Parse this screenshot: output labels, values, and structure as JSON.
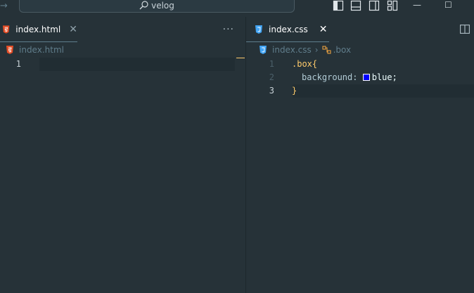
{
  "titlebar": {
    "search_text": "velog",
    "back_icon": "arrow-right-icon",
    "layout_icons": [
      "toggle-primary-sidebar-icon",
      "toggle-panel-icon",
      "toggle-secondary-sidebar-icon",
      "customize-layout-icon"
    ],
    "controls": {
      "minimize": "—",
      "maximize": "☐"
    }
  },
  "left_pane": {
    "tab": {
      "label": "index.html",
      "close": "✕",
      "icon": "html5-icon",
      "icon_color": "#e44d26"
    },
    "more_actions": "···",
    "breadcrumb": {
      "file": "index.html"
    },
    "lines": [
      {
        "number": "1",
        "text": ""
      }
    ]
  },
  "right_pane": {
    "tab": {
      "label": "index.css",
      "close": "✕",
      "icon": "css3-icon",
      "icon_color": "#42a5f5"
    },
    "split_editor_icon": "split-editor-icon",
    "breadcrumb": {
      "file": "index.css",
      "symbol": ".box",
      "symbol_icon": "css-rule-icon"
    },
    "lines": [
      {
        "number": "1",
        "selector": ".box",
        "open_brace": "{"
      },
      {
        "number": "2",
        "property": "background",
        "colon": ":",
        "value": "blue",
        "semicolon": ";",
        "swatch_color": "#0000ff"
      },
      {
        "number": "3",
        "close_brace": "}"
      }
    ]
  },
  "colors": {
    "editor_bg": "#263238",
    "accent_yellow": "#ffcb6b"
  }
}
